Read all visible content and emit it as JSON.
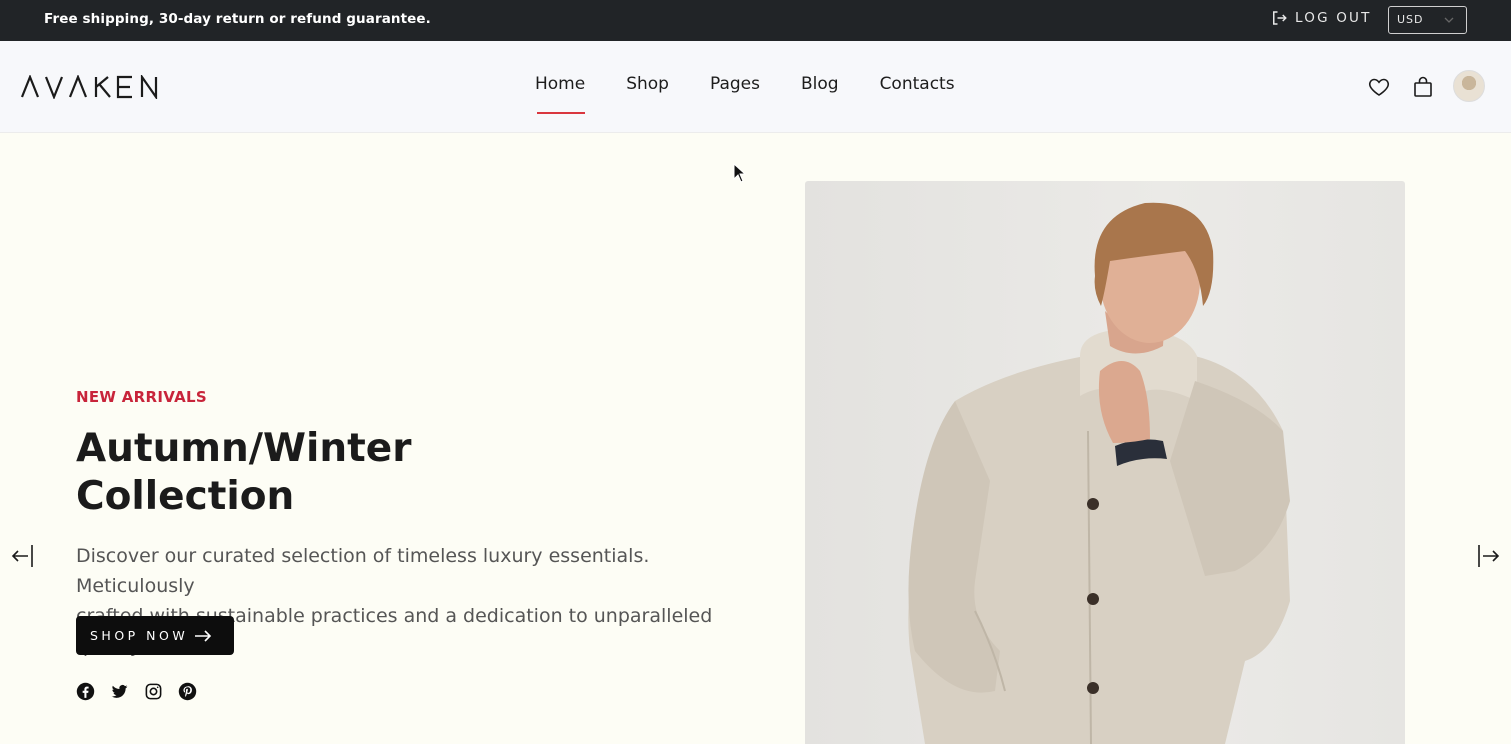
{
  "topbar": {
    "promo": "Free shipping, 30-day return or refund guarantee.",
    "logout_label": "LOG OUT",
    "logout_icon": "logout-icon",
    "currency": "USD"
  },
  "header": {
    "brand": "AVAKEN",
    "nav": [
      {
        "label": "Home",
        "active": true
      },
      {
        "label": "Shop",
        "active": false
      },
      {
        "label": "Pages",
        "active": false
      },
      {
        "label": "Blog",
        "active": false
      },
      {
        "label": "Contacts",
        "active": false
      }
    ],
    "icons": [
      "heart-icon",
      "shopping-bag-icon",
      "avatar"
    ]
  },
  "hero": {
    "eyebrow": "NEW ARRIVALS",
    "title_line1": "Autumn/Winter",
    "title_line2": "Collection",
    "description_line1": "Discover our curated selection of timeless luxury essentials. Meticulously",
    "description_line2": "crafted with sustainable practices and a dedication to unparalleled quality.",
    "cta_label": "SHOP NOW",
    "socials": [
      "facebook-icon",
      "twitter-icon",
      "instagram-icon",
      "pinterest-icon"
    ],
    "prev_icon": "arrow-left-icon",
    "next_icon": "arrow-right-icon"
  },
  "colors": {
    "topbar_bg": "#212427",
    "accent": "#c8243a",
    "nav_underline": "#d9363e",
    "cta_bg": "#0d0d0d",
    "page_bg": "#fdfdf5"
  }
}
